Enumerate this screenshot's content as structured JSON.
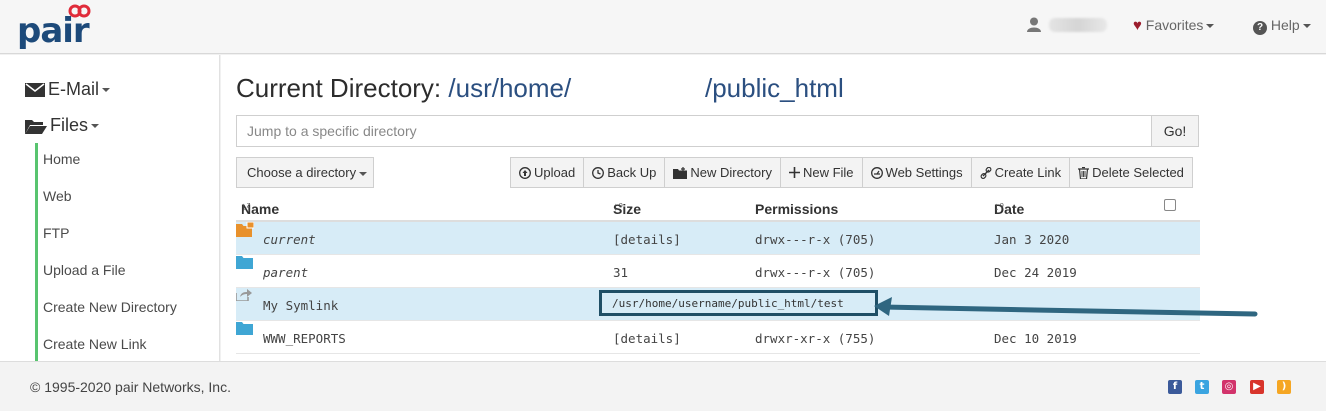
{
  "header": {
    "brand": "pair",
    "favorites": "Favorites",
    "help": "Help"
  },
  "sidebar": {
    "email": "E-Mail",
    "files": "Files",
    "items": [
      "Home",
      "Web",
      "FTP",
      "Upload a File",
      "Create New Directory",
      "Create New Link"
    ]
  },
  "main": {
    "title_label": "Current Directory:",
    "path_prefix": "/usr/home/",
    "path_suffix": "/public_html",
    "jump_placeholder": "Jump to a specific directory",
    "go": "Go!",
    "choose": "Choose a directory",
    "toolbar": {
      "upload": "Upload",
      "backup": "Back Up",
      "new_directory": "New Directory",
      "new_file": "New File",
      "web_settings": "Web Settings",
      "create_link": "Create Link",
      "delete_selected": "Delete Selected"
    },
    "columns": {
      "name": "Name",
      "size": "Size",
      "permissions": "Permissions",
      "date": "Date"
    },
    "rows": [
      {
        "name": "current",
        "size": "[details]",
        "perms": "drwx---r-x (705)",
        "date": "Jan  3 2020"
      },
      {
        "name": "parent",
        "size": "31",
        "perms": "drwx---r-x (705)",
        "date": "Dec 24 2019"
      },
      {
        "name": "My Symlink",
        "size": "/usr/home/username/public_html/test",
        "perms": "",
        "date": ""
      },
      {
        "name": "WWW_REPORTS",
        "size": "[details]",
        "perms": "drwxr-xr-x (755)",
        "date": "Dec 10 2019"
      }
    ]
  },
  "footer": {
    "copyright": "© 1995-2020 pair Networks, Inc."
  },
  "colors": {
    "brand": "#1d4a7a",
    "accent_green": "#58c46f",
    "row_highlight": "#d7ecf7",
    "arrow": "#2f6680"
  }
}
